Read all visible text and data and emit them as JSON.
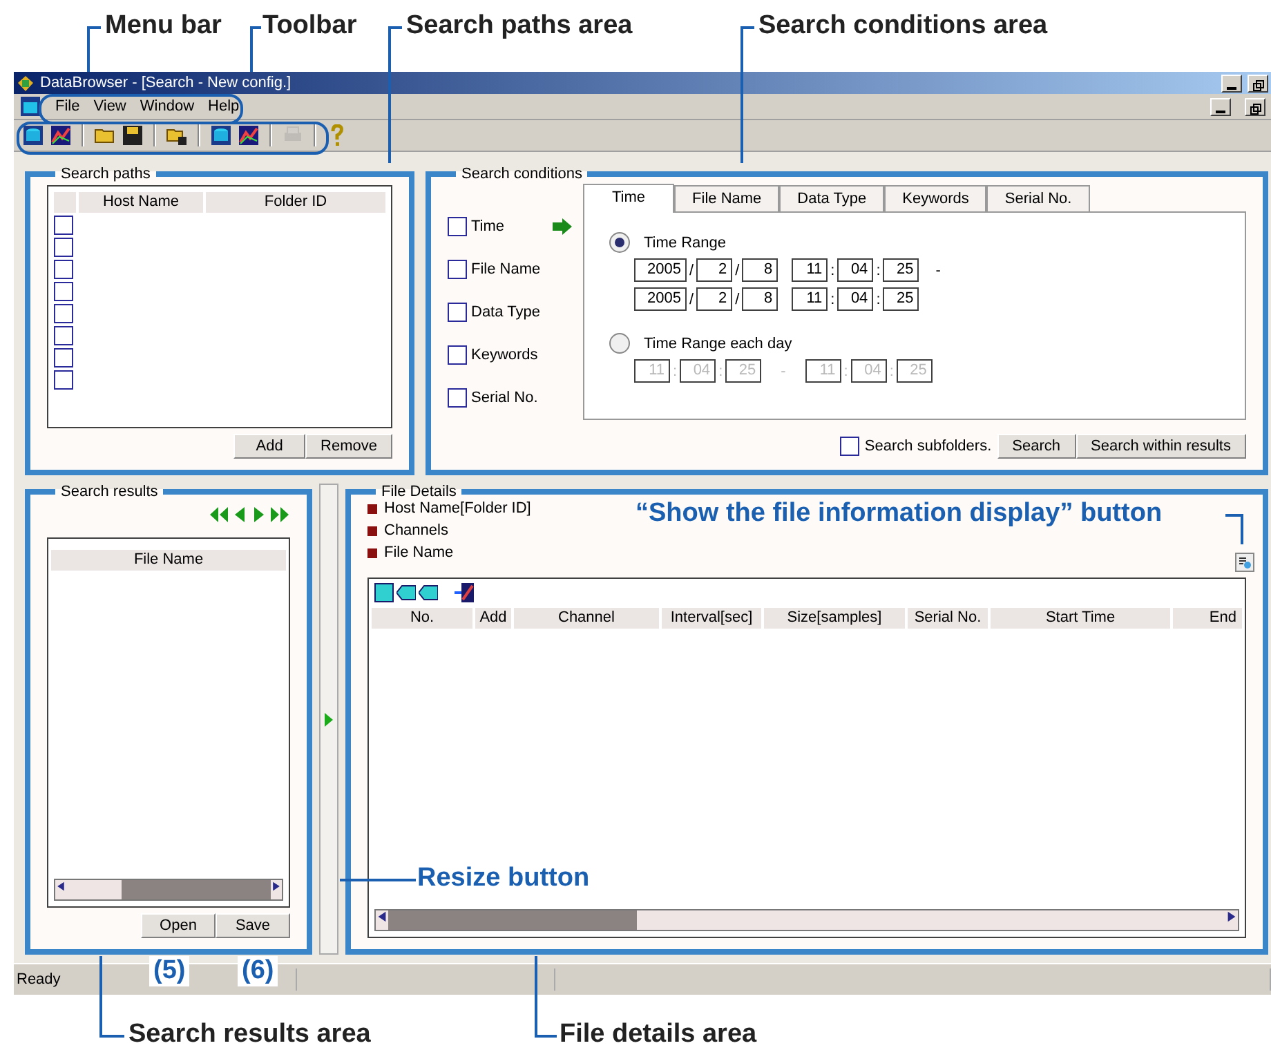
{
  "window": {
    "title": "DataBrowser - [Search - New config.]"
  },
  "menu": [
    {
      "label": "File"
    },
    {
      "label": "View"
    },
    {
      "label": "Window"
    },
    {
      "label": "Help"
    }
  ],
  "toolbar": [
    [
      {
        "kind": "database",
        "disabled": false
      },
      {
        "kind": "chart",
        "disabled": false
      }
    ],
    [
      {
        "kind": "folder",
        "disabled": false
      },
      {
        "kind": "save",
        "disabled": false
      }
    ],
    [
      {
        "kind": "folder-lock",
        "disabled": false
      }
    ],
    [
      {
        "kind": "database",
        "disabled": false
      },
      {
        "kind": "chart",
        "disabled": false
      }
    ],
    [
      {
        "kind": "printer",
        "disabled": true
      }
    ],
    [
      {
        "kind": "help",
        "disabled": false
      }
    ]
  ],
  "search_paths": {
    "title": "Search paths",
    "columns": [
      "Host Name",
      "Folder ID"
    ],
    "rows": [
      {
        "checked": false
      },
      {
        "checked": false
      },
      {
        "checked": false
      },
      {
        "checked": false
      },
      {
        "checked": false
      },
      {
        "checked": false
      },
      {
        "checked": false
      },
      {
        "checked": false
      }
    ],
    "buttons": [
      "Add",
      "Remove"
    ]
  },
  "search_conditions": {
    "title": "Search conditions",
    "criteria": [
      {
        "label": "Time",
        "checked": false,
        "selected": true
      },
      {
        "label": "File Name",
        "checked": false,
        "selected": false
      },
      {
        "label": "Data Type",
        "checked": false,
        "selected": false
      },
      {
        "label": "Keywords",
        "checked": false,
        "selected": false
      },
      {
        "label": "Serial No.",
        "checked": false,
        "selected": false
      }
    ],
    "tabs": [
      {
        "label": "Time",
        "selected": true
      },
      {
        "label": "File Name",
        "selected": false
      },
      {
        "label": "Data Type",
        "selected": false
      },
      {
        "label": "Keywords",
        "selected": false
      },
      {
        "label": "Serial No.",
        "selected": false
      }
    ],
    "time_modes": [
      {
        "kind": "stacked",
        "label": "Time Range",
        "selected": true,
        "disabled": false,
        "separator": "-",
        "ranges": [
          {
            "date": [
              "2005",
              "2",
              "8"
            ],
            "date_sep": [
              "/",
              "/"
            ],
            "time": [
              "11",
              "04",
              "25"
            ],
            "time_sep": [
              ":",
              ":"
            ]
          },
          {
            "date": [
              "2005",
              "2",
              "8"
            ],
            "date_sep": [
              "/",
              "/"
            ],
            "time": [
              "11",
              "04",
              "25"
            ],
            "time_sep": [
              ":",
              ":"
            ]
          }
        ]
      },
      {
        "kind": "inline",
        "label": "Time Range each day",
        "selected": false,
        "disabled": true,
        "separator": "-",
        "ranges": [
          {
            "time": [
              "11",
              "04",
              "25"
            ],
            "time_sep": [
              ":",
              ":"
            ]
          },
          {
            "time": [
              "11",
              "04",
              "25"
            ],
            "time_sep": [
              ":",
              ":"
            ]
          }
        ]
      }
    ],
    "subfolders": {
      "label": "Search subfolders.",
      "checked": false
    },
    "buttons": [
      "Search",
      "Search within results"
    ]
  },
  "search_results": {
    "title": "Search results",
    "column": "File Name",
    "buttons": [
      "Open",
      "Save"
    ]
  },
  "file_details": {
    "title": "File Details",
    "items": [
      "Host Name[Folder ID]",
      "Channels",
      "File Name"
    ],
    "columns": [
      "No.",
      "Add",
      "Channel",
      "Interval[sec]",
      "Size[samples]",
      "Serial No.",
      "Start Time",
      "End"
    ]
  },
  "status_bar": {
    "text": "Ready"
  },
  "callouts": [
    {
      "kind": "area",
      "label": "Menu bar"
    },
    {
      "kind": "area",
      "label": "Toolbar"
    },
    {
      "kind": "area",
      "label": "Search paths area"
    },
    {
      "kind": "area",
      "label": "Search conditions area"
    },
    {
      "kind": "button",
      "label": "“Show the file information display” button"
    },
    {
      "kind": "button",
      "label": "Resize button"
    },
    {
      "kind": "area",
      "label": "Search results area"
    },
    {
      "kind": "area",
      "label": "File details area"
    },
    {
      "kind": "number",
      "label": "(5)"
    },
    {
      "kind": "number",
      "label": "(6)"
    }
  ]
}
